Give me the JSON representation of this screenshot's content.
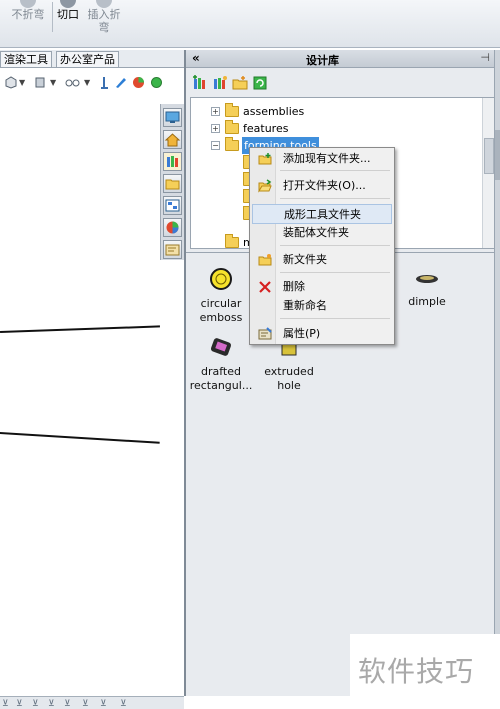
{
  "ribbon": {
    "buttons": [
      {
        "label": "不折弯",
        "icon": "unfold-icon"
      },
      {
        "label": "切口",
        "icon": "rip-icon"
      },
      {
        "label": "插入折弯",
        "icon": "insert-bends-icon"
      }
    ]
  },
  "command_tabs": [
    "渲染工具",
    "办公室产品"
  ],
  "design_library": {
    "title": "设计库",
    "collapse_glyph": "«",
    "pin_glyph": "⊣",
    "tree": [
      {
        "label": "assemblies",
        "expander": "+"
      },
      {
        "label": "features",
        "expander": "+"
      },
      {
        "label": "forming tools",
        "expander": "−",
        "selected": true
      },
      {
        "label": "m",
        "expander": ""
      }
    ],
    "files": [
      {
        "label": "circular emboss",
        "icon": "circular-emboss-icon"
      },
      {
        "label": "dimple",
        "icon": "dimple-icon"
      },
      {
        "label": "drafted rectangul...",
        "icon": "drafted-rectangular-icon"
      },
      {
        "label": "extruded hole",
        "icon": "extruded-hole-icon"
      }
    ]
  },
  "context_menu": {
    "items": [
      {
        "label": "添加现有文件夹...",
        "icon": "add-folder-icon"
      },
      {
        "label": "打开文件夹(O)...",
        "icon": "open-folder-icon"
      },
      {
        "label": "成形工具文件夹",
        "icon": ""
      },
      {
        "label": "装配体文件夹",
        "icon": ""
      },
      {
        "label": "新文件夹",
        "icon": "new-folder-icon"
      },
      {
        "label": "删除",
        "icon": "delete-icon"
      },
      {
        "label": "重新命名",
        "icon": ""
      },
      {
        "label": "属性(P)",
        "icon": "properties-icon"
      }
    ],
    "highlighted": "成形工具文件夹"
  },
  "watermark": "软件技巧",
  "colors": {
    "selection": "#3f8fdc",
    "folder": "#f5cf58",
    "delete": "#d62020",
    "panel_bg": "#e8ebef"
  }
}
